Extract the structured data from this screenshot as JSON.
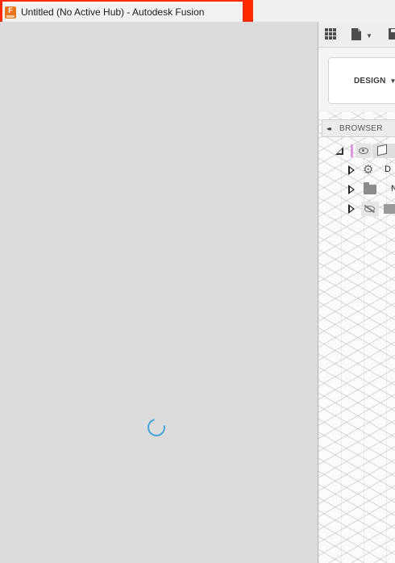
{
  "window": {
    "title": "Untitled (No Active Hub) - Autodesk Fusion",
    "app_icon_letter": "F",
    "highlight_color": "#ff2a00"
  },
  "loading": {
    "spinner_color": "#44a6d8"
  },
  "toolbar": {
    "icons": [
      "apps-grid-icon",
      "file-icon",
      "dropdown-caret-icon",
      "save-icon"
    ]
  },
  "workspace": {
    "label": "DESIGN",
    "caret": "▼"
  },
  "browser": {
    "label": "BROWSER",
    "collapse_glyph": "◂◂",
    "rows": [
      {
        "label": "D",
        "icon": "gear-icon"
      },
      {
        "label": "N",
        "icon": "folder-icon"
      },
      {
        "label": "",
        "icon": "hidden-eye-icon"
      }
    ]
  }
}
